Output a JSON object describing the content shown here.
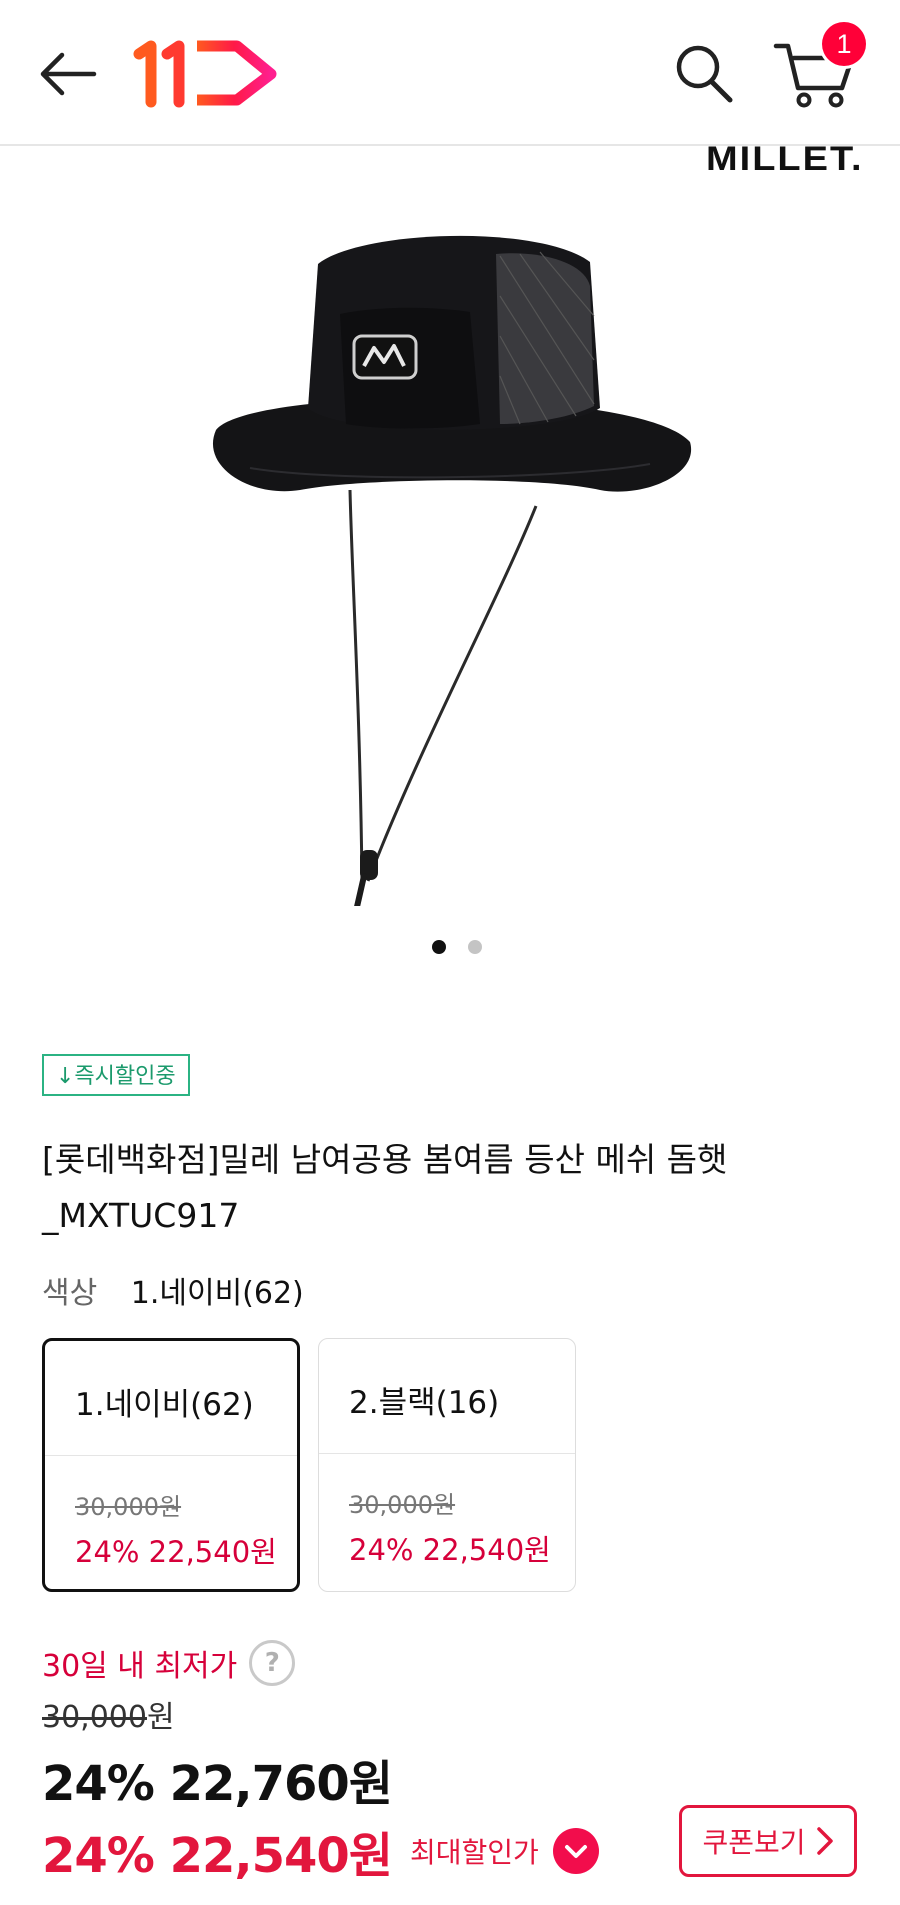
{
  "header": {
    "back_icon": "arrow-left-icon",
    "logo_text": "11",
    "search_icon": "search-icon",
    "cart_icon": "cart-icon",
    "cart_count": "1",
    "accent_color": "#ff0038"
  },
  "gallery": {
    "brand_mark": "MILLET.",
    "image_subject": "black bucket hat with mesh side panels and chin strap",
    "page_index": 1,
    "page_total": 2
  },
  "product": {
    "badge": "↓즉시할인중",
    "title": "[롯데백화점]밀레 남여공용 봄여름 등산 메쉬 돔햇_MXTUC917",
    "color_label": "색상",
    "color_selected": "1.네이비(62)",
    "options": [
      {
        "name": "1.네이비(62)",
        "original_price": "30,000원",
        "sale_price": "24% 22,540원",
        "selected": true
      },
      {
        "name": "2.블랙(16)",
        "original_price": "30,000원",
        "sale_price": "24% 22,540원",
        "selected": false
      }
    ],
    "lowest_label": "30일 내 최저가",
    "help_icon": "question-circle-icon",
    "original_price_num": "30,000",
    "original_price_unit": "원",
    "discount_price": "24% 22,760원",
    "best_price": "24% 22,540원",
    "best_label": "최대할인가",
    "best_icon": "chevron-down-circle-icon",
    "coupon_button": "쿠폰보기",
    "coupon_icon": "chevron-right-icon",
    "price_color": "#e2163d",
    "badge_color": "#2bb383"
  }
}
